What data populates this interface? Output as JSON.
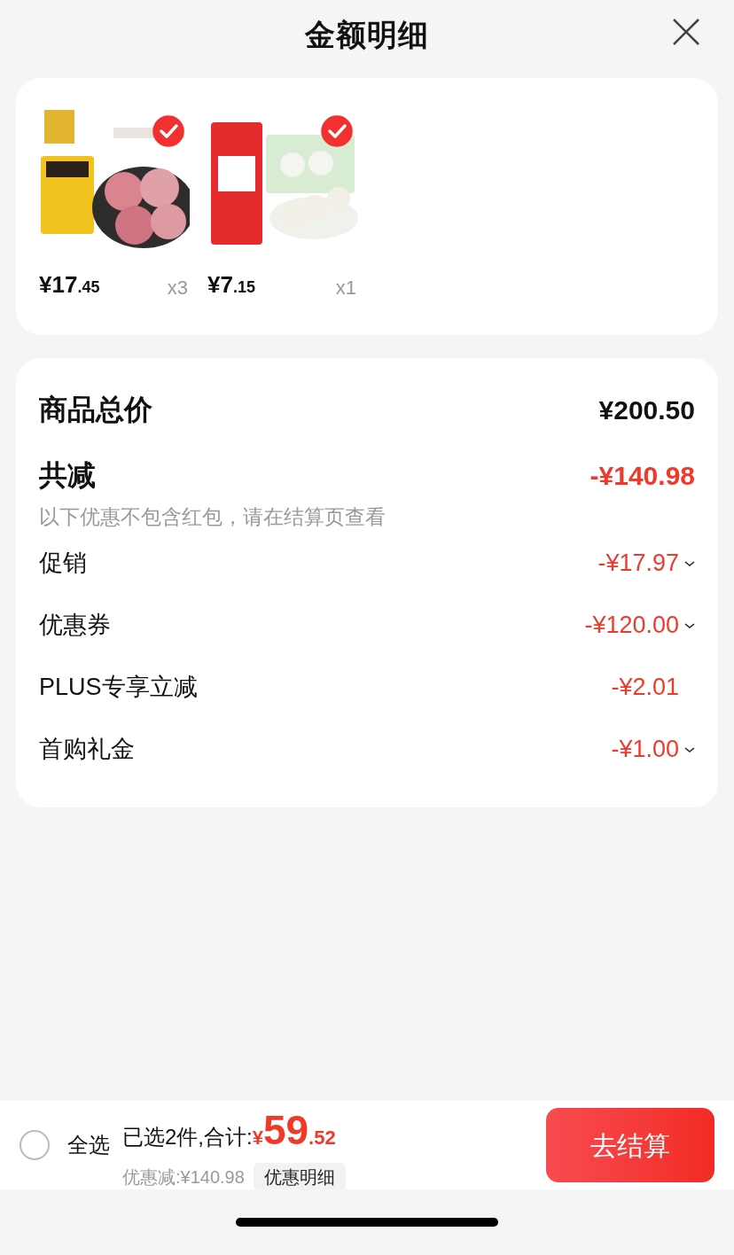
{
  "header": {
    "title": "金额明细"
  },
  "products": [
    {
      "kind": "picture",
      "selected": true,
      "price": "¥17",
      "price_decimal": ".45",
      "quantity": "x3"
    },
    {
      "kind": "picture",
      "selected": true,
      "price": "¥7",
      "price_decimal": ".15",
      "quantity": "x1"
    }
  ],
  "summary": {
    "total_label": "商品总价",
    "total_value": "¥200.50",
    "discount_label": "共减",
    "discount_value": "-¥140.98",
    "note": "以下优惠不包含红包，请在结算页查看",
    "items": [
      {
        "label": "促销",
        "amount": "-¥17.97",
        "has_details": true
      },
      {
        "label": "优惠券",
        "amount": "-¥120.00",
        "has_details": true
      },
      {
        "label": "PLUS专享立减",
        "amount": "-¥2.01",
        "has_details": false
      },
      {
        "label": "首购礼金",
        "amount": "-¥1.00",
        "has_details": true
      }
    ]
  },
  "bottom_bar": {
    "select_all": {
      "label": "全选",
      "checked": false
    },
    "selected_text": "已选2件,合计:",
    "currency": "¥",
    "total_int": "59",
    "total_decimal": ".52",
    "saved_text": "优惠减:¥140.98",
    "details_button": "优惠明细",
    "checkout_button": "去结算"
  }
}
